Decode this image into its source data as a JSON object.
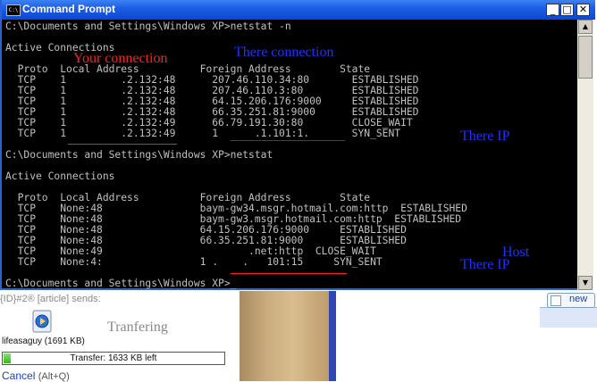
{
  "window": {
    "title": "Command Prompt",
    "icon_label": "C:\\",
    "minimize_label": "_",
    "maximize_label": "□",
    "close_label": "✕"
  },
  "console": {
    "lines": [
      "C:\\Documents and Settings\\Windows XP>netstat -n",
      "",
      "Active Connections",
      "",
      "  Proto  Local Address          Foreign Address        State",
      "  TCP    1         .2.132:48      207.46.110.34:80       ESTABLISHED",
      "  TCP    1         .2.132:48      207.46.110.3:80        ESTABLISHED",
      "  TCP    1         .2.132:48      64.15.206.176:9000     ESTABLISHED",
      "  TCP    1         .2.132:48      66.35.251.81:9000      ESTABLISHED",
      "  TCP    1         .2.132:49      66.79.191.30:80        CLOSE_WAIT",
      "  TCP    1         .2.132:49      1      .1.101:1.       SYN_SENT",
      "",
      "C:\\Documents and Settings\\Windows XP>netstat",
      "",
      "Active Connections",
      "",
      "  Proto  Local Address          Foreign Address        State",
      "  TCP    None:48                baym-gw34.msgr.hotmail.com:http  ESTABLISHED",
      "  TCP    None:48                baym-gw3.msgr.hotmail.com:http  ESTABLISHED",
      "  TCP    None:48                64.15.206.176:9000     ESTABLISHED",
      "  TCP    None:48                66.35.251.81:9000      ESTABLISHED",
      "  TCP    None:49                        .net:http  CLOSE_WAIT",
      "  TCP    None:4:                1 .    .   101:15     SYN_SENT",
      "",
      "C:\\Documents and Settings\\Windows XP>_"
    ]
  },
  "annotations": {
    "your_connection": "Your connection",
    "there_connection": "There connection",
    "there_ip_1": "There IP",
    "host": "Host",
    "there_ip_2": "There IP",
    "tranfering": "Tranfering"
  },
  "messenger": {
    "sender_line": "{ID}#2® [article] sends:",
    "file_name": "lifeasaguy (1691 KB)",
    "progress_text": "Transfer: 1633 KB left",
    "progress_fraction": 0.034,
    "cancel_label": "Cancel",
    "cancel_hotkey": "(Alt+Q)",
    "new_button_label": "new"
  },
  "colors": {
    "title_bar": "#0a48d4",
    "console_bg": "#000000",
    "console_text": "#c0c0c0",
    "annotation_red": "#ff2020",
    "annotation_blue": "#2030ff",
    "progress_fill": "#33b81e"
  },
  "icons": {
    "window_icon": "cmd-icon",
    "file_icon": "media-file-icon"
  }
}
